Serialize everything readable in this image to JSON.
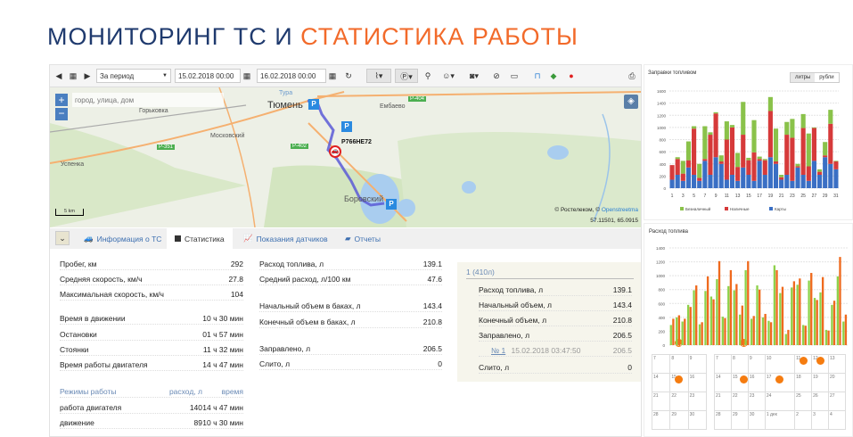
{
  "title": {
    "part1": "МОНИТОРИНГ ТС И ",
    "part2": "СТАТИСТИКА РАБОТЫ"
  },
  "toolbar": {
    "period": "За период",
    "date_from": "15.02.2018 00:00",
    "date_to": "16.02.2018 00:00"
  },
  "map": {
    "search_placeholder": "город, улица, дом",
    "labels": [
      "Тюмень",
      "Горьковка",
      "Московский",
      "Успенка",
      "Боровский",
      "Ембаево",
      "Тура",
      "Р-351",
      "Р-402",
      "Р-404"
    ],
    "vehicle": "Р766НЕ72",
    "scale": "5 km",
    "attribution_prefix": "© Ростелеком, © ",
    "attribution_link": "Openstreetma",
    "coords": "57.11501, 65.0915",
    "route_color": "#5b5bd6"
  },
  "tabs": [
    {
      "label": "Информация о ТС"
    },
    {
      "label": "Статистика"
    },
    {
      "label": "Показания датчиков"
    },
    {
      "label": "Отчеты"
    }
  ],
  "stats_left": [
    {
      "k": "Пробег, км",
      "v": "292"
    },
    {
      "k": "Средняя скорость, км/ч",
      "v": "27.8"
    },
    {
      "k": "Максимальная скорость, км/ч",
      "v": "104"
    },
    {
      "k": "Время в движении",
      "v": "10 ч 30 мин"
    },
    {
      "k": "Остановки",
      "v": "01 ч 57 мин"
    },
    {
      "k": "Стоянки",
      "v": "11 ч 32 мин"
    },
    {
      "k": "Время работы двигателя",
      "v": "14 ч 47 мин"
    }
  ],
  "modes": {
    "headers": [
      "Режимы работы",
      "расход, л",
      "время"
    ],
    "rows": [
      [
        "работа двигателя",
        "140",
        "14 ч 47 мин"
      ],
      [
        "движение",
        "89",
        "10 ч 30 мин"
      ]
    ]
  },
  "stats_mid": [
    {
      "k": "Расход топлива, л",
      "v": "139.1"
    },
    {
      "k": "Средний расход, л/100 км",
      "v": "47.6"
    },
    {
      "k": "Начальный объем в баках, л",
      "v": "143.4"
    },
    {
      "k": "Конечный объем в баках, л",
      "v": "210.8"
    },
    {
      "k": "Заправлено, л",
      "v": "206.5"
    },
    {
      "k": "Слито, л",
      "v": "0"
    }
  ],
  "tank": {
    "header": "1 (410л)",
    "rows": [
      {
        "k": "Расход топлива, л",
        "v": "139.1"
      },
      {
        "k": "Начальный объем, л",
        "v": "143.4"
      },
      {
        "k": "Конечный объем, л",
        "v": "210.8"
      },
      {
        "k": "Заправлено, л",
        "v": "206.5"
      }
    ],
    "refuel": {
      "num": "№ 1",
      "time": "15.02.2018 03:47:50",
      "v": "206.5"
    },
    "drain": {
      "k": "Слито, л",
      "v": "0"
    }
  },
  "chart_data": [
    {
      "type": "bar",
      "stacked": true,
      "title": "Заправки топливом",
      "toggle": [
        "литры",
        "рубли"
      ],
      "ylim": [
        0,
        1600
      ],
      "yticks": [
        0,
        200,
        400,
        600,
        800,
        1000,
        1200,
        1400,
        1600
      ],
      "xtick_labels": [
        "1",
        "3",
        "5",
        "7",
        "9",
        "11",
        "13",
        "15",
        "17",
        "19",
        "21",
        "23",
        "25",
        "27",
        "29",
        "31"
      ],
      "categories": [
        1,
        2,
        3,
        4,
        5,
        6,
        7,
        8,
        9,
        10,
        11,
        12,
        13,
        14,
        15,
        16,
        17,
        18,
        19,
        20,
        21,
        22,
        23,
        24,
        25,
        26,
        27,
        28,
        29,
        30,
        31
      ],
      "series": [
        {
          "name": "Карты",
          "color": "#3a6fc4",
          "values": [
            140,
            220,
            120,
            340,
            220,
            120,
            450,
            220,
            510,
            400,
            140,
            220,
            120,
            340,
            220,
            120,
            450,
            220,
            510,
            400,
            140,
            220,
            120,
            340,
            220,
            120,
            450,
            220,
            510,
            400,
            310
          ]
        },
        {
          "name": "Наличные",
          "color": "#d63a3a",
          "values": [
            240,
            260,
            120,
            120,
            760,
            50,
            30,
            660,
            720,
            40,
            660,
            780,
            230,
            540,
            240,
            470,
            30,
            240,
            760,
            40,
            40,
            660,
            710,
            20,
            770,
            240,
            540,
            50,
            30,
            660,
            130
          ]
        },
        {
          "name": "Безналичный",
          "color": "#8ac24a",
          "values": [
            0,
            30,
            210,
            310,
            40,
            230,
            540,
            40,
            20,
            100,
            300,
            40,
            230,
            540,
            40,
            530,
            40,
            20,
            230,
            540,
            40,
            210,
            310,
            40,
            230,
            540,
            10,
            40,
            220,
            230,
            10
          ]
        }
      ]
    },
    {
      "type": "bar",
      "title": "Расход топлива",
      "ylim": [
        0,
        1400
      ],
      "yticks": [
        0,
        200,
        400,
        600,
        800,
        1000,
        1200,
        1400
      ],
      "categories": [
        1,
        2,
        3,
        4,
        5,
        6,
        7,
        8,
        9,
        10,
        11,
        12,
        13,
        14,
        15,
        16,
        17,
        18,
        19,
        20,
        21,
        22,
        23,
        24,
        25,
        26,
        27,
        28,
        29,
        30,
        31
      ],
      "series": [
        {
          "name": "green",
          "color": "#8ed14a",
          "values": [
            290,
            400,
            340,
            580,
            790,
            300,
            780,
            700,
            950,
            410,
            850,
            790,
            440,
            1080,
            380,
            860,
            400,
            350,
            1150,
            750,
            160,
            830,
            870,
            290,
            930,
            680,
            760,
            220,
            580,
            990,
            340
          ]
        },
        {
          "name": "orange",
          "color": "#ef6a1e",
          "values": [
            380,
            430,
            380,
            550,
            860,
            330,
            990,
            660,
            1210,
            390,
            1080,
            880,
            570,
            1210,
            420,
            800,
            450,
            330,
            1080,
            840,
            220,
            920,
            960,
            280,
            1040,
            650,
            980,
            210,
            640,
            1270,
            440
          ]
        }
      ]
    }
  ],
  "calendar": {
    "left": [
      [
        "7",
        "8",
        "9"
      ],
      [
        "14",
        "15",
        "16"
      ],
      [
        "21",
        "22",
        "23"
      ],
      [
        "28",
        "29",
        "30"
      ]
    ],
    "right": [
      [
        "7",
        "8",
        "9",
        "10",
        "11",
        "12",
        "13"
      ],
      [
        "14",
        "15",
        "16",
        "17",
        "18",
        "19",
        "20"
      ],
      [
        "21",
        "22",
        "23",
        "24",
        "25",
        "26",
        "27"
      ],
      [
        "28",
        "29",
        "30",
        "1 дек",
        "2",
        "3",
        "4"
      ]
    ]
  }
}
